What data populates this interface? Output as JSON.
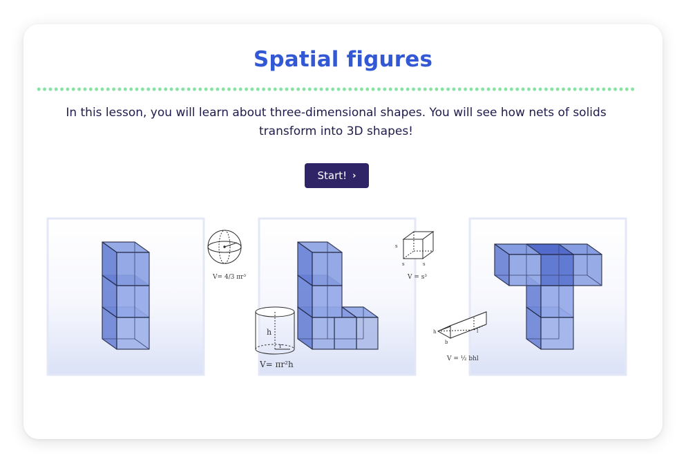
{
  "lesson": {
    "title": "Spatial figures",
    "description": "In this lesson, you will learn about three-dimensional shapes. You will see how nets of solids transform into 3D shapes!",
    "start_label": "Start!",
    "start_icon": "chevron-right-icon"
  },
  "illustration": {
    "formulas": {
      "sphere": "V= 4/3 πr³",
      "cylinder": "V= πr²h",
      "cube": "V = s³",
      "prism": "V = ½ bhl"
    },
    "labels": {
      "h": "h",
      "r": "r",
      "s": "s",
      "b": "b",
      "l": "l"
    }
  },
  "colors": {
    "title": "#3358d4",
    "divider_dots": "#86e3a3",
    "button": "#2e2466",
    "cube_fill": "#7f96e2",
    "cube_stroke": "#222a48"
  }
}
